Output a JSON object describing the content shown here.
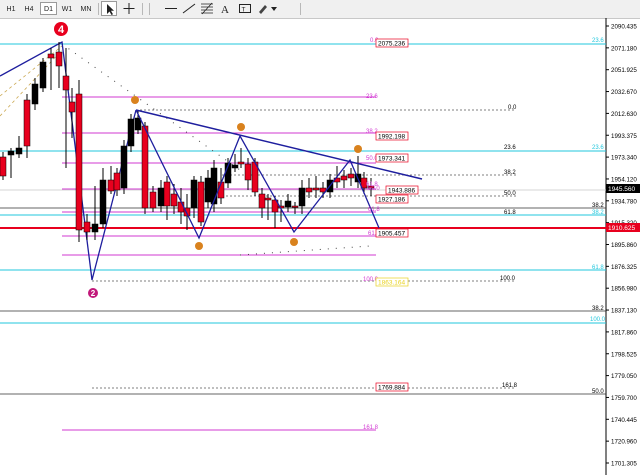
{
  "toolbar": {
    "timeframes": [
      {
        "label": "H1",
        "active": false
      },
      {
        "label": "H4",
        "active": false
      },
      {
        "label": "D1",
        "active": true
      },
      {
        "label": "W1",
        "active": false
      },
      {
        "label": "MN",
        "active": false
      }
    ],
    "tools": [
      "cursor-icon",
      "crosshair-icon",
      "horizontal-line-icon",
      "trendline-icon",
      "fibonacci-icon",
      "text-icon",
      "label-icon",
      "draw-menu-icon"
    ]
  },
  "price_axis": {
    "ticks": [
      "2090.435",
      "2071.180",
      "2051.925",
      "2032.670",
      "2012.630",
      "1993.375",
      "1973.340",
      "1954.120",
      "1934.780",
      "1915.320",
      "1895.860",
      "1876.325",
      "1856.980",
      "1837.130",
      "1817.860",
      "1798.525",
      "1779.050",
      "1759.700",
      "1740.445",
      "1720.960",
      "1701.305",
      "61.8"
    ],
    "current_price": "1945.560",
    "red_level_price": "1910.625"
  },
  "markers": {
    "wave_4": "4",
    "wave_2": "2"
  },
  "fib_labels": {
    "small": [
      "0.0",
      "23.6",
      "38.2",
      "50.0",
      "61.8",
      "100.0",
      "161.8",
      "0.0",
      "23.6",
      "38.2",
      "50.0",
      "61.8",
      "100.0",
      "23.6",
      "38.2",
      "61.8",
      "100.0",
      "161.8",
      "50.0",
      "23.6",
      "38.2",
      "50.0",
      "61.8",
      "38.2",
      "61.8"
    ],
    "boxed": [
      "2075.236",
      "1992.198",
      "1973.341",
      "1943.886",
      "1927.186",
      "1905.457",
      "1863.164",
      "1769.884"
    ]
  },
  "colors": {
    "bull": "#000000",
    "bear": "#e8001e",
    "support": "#e8001e",
    "fib_magenta": "#d23ad2",
    "fib_cyan": "#22c7dd",
    "pattern": "#1e1e9e",
    "point": "#d9821e"
  }
}
